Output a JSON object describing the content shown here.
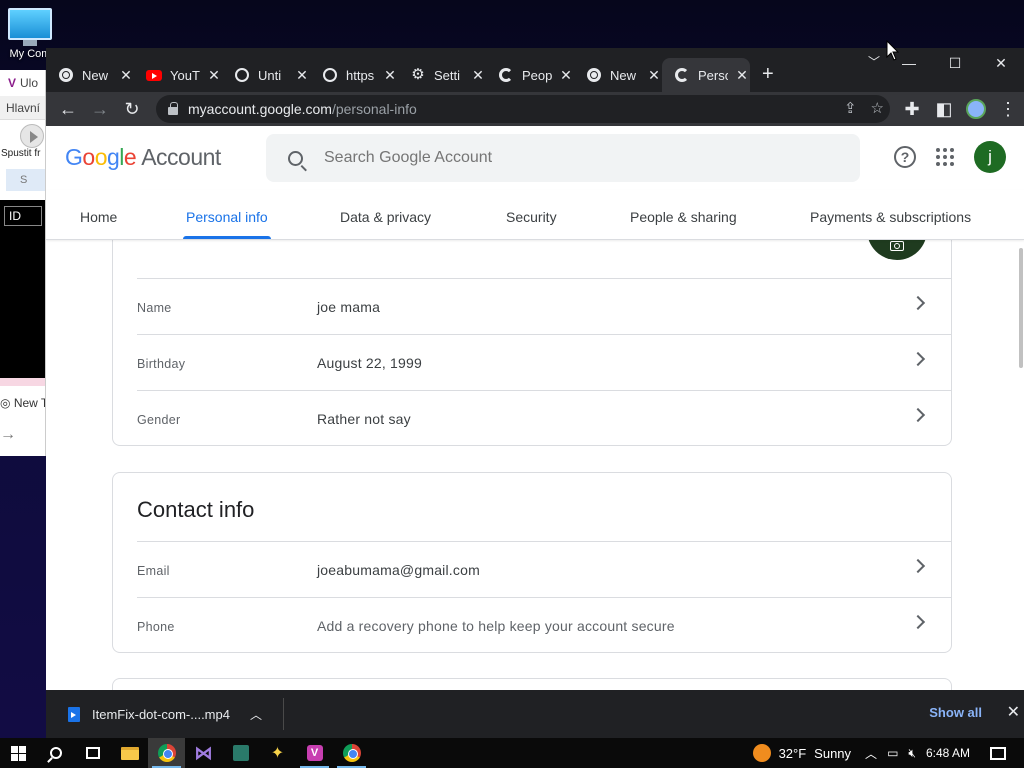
{
  "desktop": {
    "icon_label": "My Com"
  },
  "background_window": {
    "row1": "Ulo",
    "row2": "Hlavní",
    "spustit": "Spustit fr",
    "download_field": "S",
    "id_label": "ID",
    "new_tab": "New T"
  },
  "browser": {
    "tabs": [
      {
        "title": "New",
        "icon": "chrome-icon"
      },
      {
        "title": "YouT",
        "icon": "youtube-icon"
      },
      {
        "title": "Unti",
        "icon": "globe-icon"
      },
      {
        "title": "https",
        "icon": "globe-icon"
      },
      {
        "title": "Setti",
        "icon": "gear-icon"
      },
      {
        "title": "Peop",
        "icon": "google-icon"
      },
      {
        "title": "New",
        "icon": "chrome-icon"
      },
      {
        "title": "Perso",
        "icon": "google-icon",
        "active": true
      }
    ],
    "url_host": "myaccount.google.com",
    "url_path": "/personal-info"
  },
  "page": {
    "logo": {
      "g1": "G",
      "o1": "o",
      "o2": "o",
      "g2": "g",
      "l": "l",
      "e": "e",
      "account": "Account"
    },
    "search_placeholder": "Search Google Account",
    "avatar_letter": "j",
    "nav": [
      "Home",
      "Personal info",
      "Data & privacy",
      "Security",
      "People & sharing",
      "Payments & subscriptions"
    ],
    "active_nav": "Personal info",
    "basic_info": {
      "name_label": "Name",
      "name_value": "joe mama",
      "birthday_label": "Birthday",
      "birthday_value": "August 22, 1999",
      "gender_label": "Gender",
      "gender_value": "Rather not say"
    },
    "contact_info": {
      "title": "Contact info",
      "email_label": "Email",
      "email_value": "joeabumama@gmail.com",
      "phone_label": "Phone",
      "phone_value": "Add a recovery phone to help keep your account secure"
    }
  },
  "download_bar": {
    "filename": "ItemFix-dot-com-....mp4",
    "show_all": "Show all"
  },
  "taskbar": {
    "temperature": "32°F",
    "condition": "Sunny",
    "time": "6:48 AM"
  },
  "colors": {
    "accent": "#1a73e8",
    "tabstrip": "#202124",
    "toolbar": "#35363a"
  }
}
